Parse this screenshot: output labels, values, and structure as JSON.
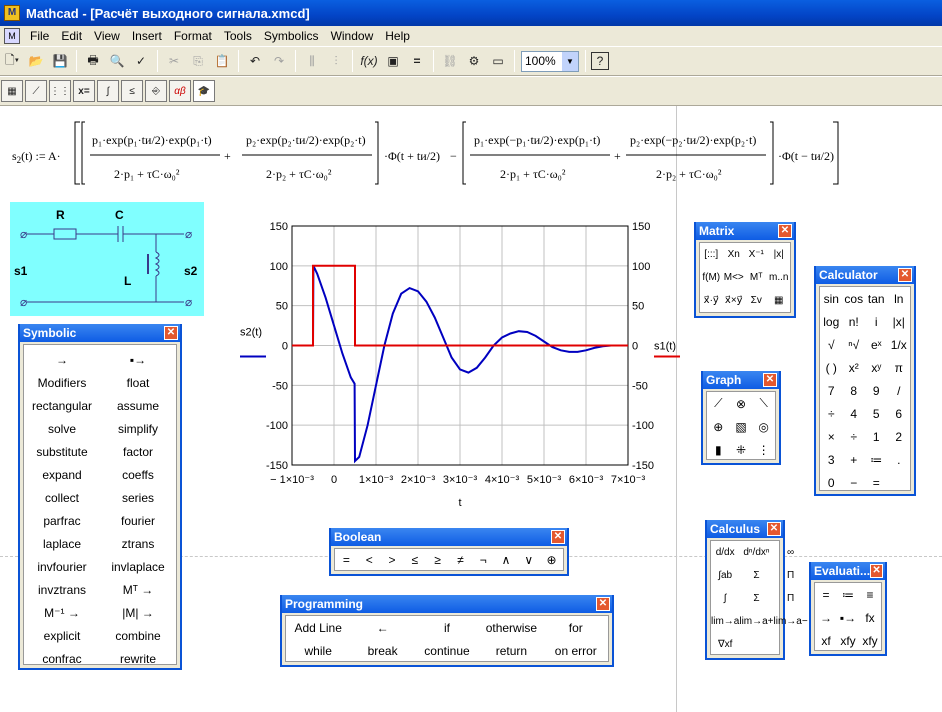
{
  "window": {
    "title": "Mathcad - [Расчёт выходного сигнала.xmcd]"
  },
  "menu": {
    "items": [
      "File",
      "Edit",
      "View",
      "Insert",
      "Format",
      "Tools",
      "Symbolics",
      "Window",
      "Help"
    ]
  },
  "toolbar": {
    "zoom": "100%"
  },
  "formula": {
    "lhs": "s2(t) := A·",
    "text": "[ (p1·exp(p1·tи/2)·exp(p1·t))/(2·p1 + τC·ω0²) + (p2·exp(p2·tи/2)·exp(p2·t))/(2·p2 + τC·ω0²) ]·Φ(t + tи/2) − [ (p1·exp(−p1·tи/2)·exp(p1·t))/(2·p1 + τC·ω0²) + (p2·exp(−p2·tи/2)·exp(p2·t))/(2·p2 + τC·ω0²) ]·Φ(t − tи/2)"
  },
  "circuit": {
    "labels": {
      "r": "R",
      "c": "C",
      "l": "L",
      "in": "s1",
      "out": "s2"
    }
  },
  "chart_data": {
    "type": "line",
    "xlabel": "t",
    "ylabel_left": "s2(t)",
    "ylabel_right": "s1(t)",
    "xlim": [
      -0.001,
      0.007
    ],
    "ylim": [
      -150,
      150
    ],
    "xticks": [
      "− 1×10⁻³",
      "0",
      "1×10⁻³",
      "2×10⁻³",
      "3×10⁻³",
      "4×10⁻³",
      "5×10⁻³",
      "6×10⁻³",
      "7×10⁻³"
    ],
    "yticks": [
      150,
      100,
      50,
      0,
      -50,
      -100,
      -150
    ],
    "series": [
      {
        "name": "s2(t)",
        "color": "#0000c0",
        "x": [
          -0.001,
          -0.0005,
          -0.00049,
          -0.0004,
          -0.0002,
          0.0,
          0.0002,
          0.0004,
          0.00049,
          0.0005,
          0.0006,
          0.0008,
          0.001,
          0.0012,
          0.0014,
          0.0016,
          0.0018,
          0.002,
          0.0022,
          0.0024,
          0.0026,
          0.0028,
          0.003,
          0.0032,
          0.0034,
          0.0036,
          0.0038,
          0.004,
          0.0042,
          0.0044,
          0.0046,
          0.0048,
          0.005,
          0.0052,
          0.0054,
          0.0056,
          0.0058,
          0.006,
          0.0062,
          0.0064,
          0.0066,
          0.0068,
          0.007
        ],
        "y": [
          0,
          0,
          100,
          90,
          60,
          25,
          -10,
          -40,
          -48,
          -145,
          -140,
          -100,
          -50,
          0,
          40,
          65,
          72,
          68,
          55,
          35,
          10,
          -15,
          -30,
          -34,
          -28,
          -15,
          0,
          10,
          15,
          18,
          17,
          12,
          5,
          -2,
          -6,
          -8,
          -8,
          -6,
          -3,
          -1,
          0,
          0,
          0
        ]
      },
      {
        "name": "s1(t)",
        "color": "#e00000",
        "x": [
          -0.001,
          -0.0005,
          -0.0005,
          0.0005,
          0.0005,
          0.007
        ],
        "y": [
          0,
          0,
          100,
          100,
          0,
          0
        ]
      }
    ]
  },
  "palettes": {
    "symbolic": {
      "title": "Symbolic",
      "items": [
        "→",
        "▪→",
        "Modifiers",
        "float",
        "rectangular",
        "assume",
        "solve",
        "simplify",
        "substitute",
        "factor",
        "expand",
        "coeffs",
        "collect",
        "series",
        "parfrac",
        "fourier",
        "laplace",
        "ztrans",
        "invfourier",
        "invlaplace",
        "invztrans",
        "Mᵀ →",
        "M⁻¹ →",
        "|M| →",
        "explicit",
        "combine",
        "confrac",
        "rewrite"
      ]
    },
    "matrix": {
      "title": "Matrix",
      "items": [
        "[:::]",
        "Xn",
        "X⁻¹",
        "|x|",
        "f(M)",
        "M<>",
        "Mᵀ",
        "m..n",
        "x⃗·y⃗",
        "x⃗×y⃗",
        "Σv",
        "▦"
      ]
    },
    "calculator": {
      "title": "Calculator",
      "items": [
        "sin",
        "cos",
        "tan",
        "ln",
        "log",
        "n!",
        "i",
        "|x|",
        "√",
        "ⁿ√",
        "eˣ",
        "1/x",
        "( )",
        "x²",
        "xʸ",
        "π",
        "7",
        "8",
        "9",
        "/",
        "÷",
        "4",
        "5",
        "6",
        "×",
        "÷",
        "1",
        "2",
        "3",
        "+",
        "≔",
        ".",
        "0",
        "−",
        "="
      ]
    },
    "graph": {
      "title": "Graph",
      "items": [
        "⟋",
        "⊗",
        "⟍",
        "⊕",
        "▧",
        "◎",
        "▮",
        "⁜",
        "⋮"
      ]
    },
    "boolean": {
      "title": "Boolean",
      "items": [
        "=",
        "<",
        ">",
        "≤",
        "≥",
        "≠",
        "¬",
        "∧",
        "∨",
        "⊕"
      ]
    },
    "programming": {
      "title": "Programming",
      "items": [
        "Add Line",
        "←",
        "if",
        "otherwise",
        "for",
        "while",
        "break",
        "continue",
        "return",
        "on error"
      ]
    },
    "calculus": {
      "title": "Calculus",
      "items": [
        "d/dx",
        "dⁿ/dxⁿ",
        "∞",
        "∫ab",
        "Σ",
        "Π",
        "∫",
        "Σ",
        "Π",
        "lim→a",
        "lim→a+",
        "lim→a−",
        "∇xf"
      ]
    },
    "evaluation": {
      "title": "Evaluati...",
      "items": [
        "=",
        "≔",
        "≡",
        "→",
        "▪→",
        "fx",
        "xf",
        "xfy",
        "xfy"
      ]
    }
  }
}
